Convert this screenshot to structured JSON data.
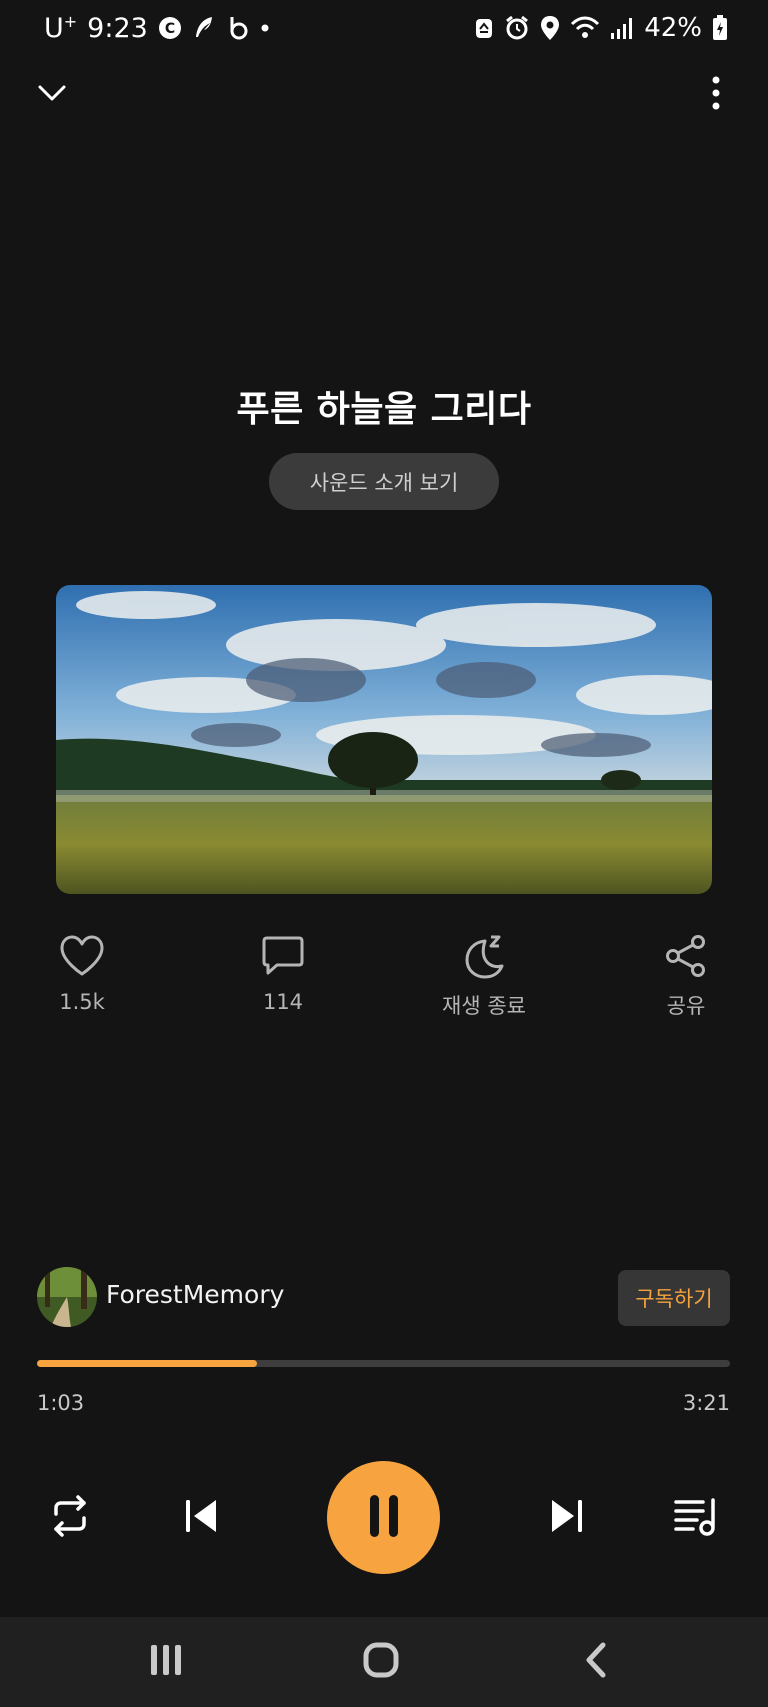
{
  "status_bar": {
    "carrier": "U",
    "carrier_sup": "+",
    "time": "9:23",
    "battery": "42%",
    "icons_left": [
      "c-circle-icon",
      "feather-icon",
      "b-circle-icon",
      "dot-icon"
    ],
    "icons_right": [
      "recycle-icon",
      "alarm-icon",
      "location-icon",
      "wifi-icon",
      "signal-icon",
      "battery-charging-icon"
    ]
  },
  "top_bar": {
    "left_icon": "chevron-down-icon",
    "right_icon": "more-vertical-icon"
  },
  "track": {
    "title": "푸른 하늘을 그리다",
    "intro_button": "사운드 소개 보기",
    "artwork": "landscape-tree-field-sky"
  },
  "actions": [
    {
      "icon": "heart-icon",
      "label": "1.5k"
    },
    {
      "icon": "comment-icon",
      "label": "114"
    },
    {
      "icon": "sleep-timer-moon-icon",
      "label": "재생 종료"
    },
    {
      "icon": "share-icon",
      "label": "공유"
    }
  ],
  "artist": {
    "name": "ForestMemory",
    "subscribe_label": "구독하기"
  },
  "playback": {
    "current_time": "1:03",
    "total_time": "3:21",
    "progress_fraction": 0.318,
    "state": "playing"
  },
  "controls": [
    "repeat-icon",
    "previous-icon",
    "pause-icon",
    "next-icon",
    "playlist-icon"
  ],
  "nav_bar": [
    "recents-icon",
    "home-icon",
    "back-icon"
  ],
  "colors": {
    "background": "#141414",
    "accent": "#f7a440",
    "subscribe_text": "#f5a13d",
    "nav_bar": "#202020"
  }
}
